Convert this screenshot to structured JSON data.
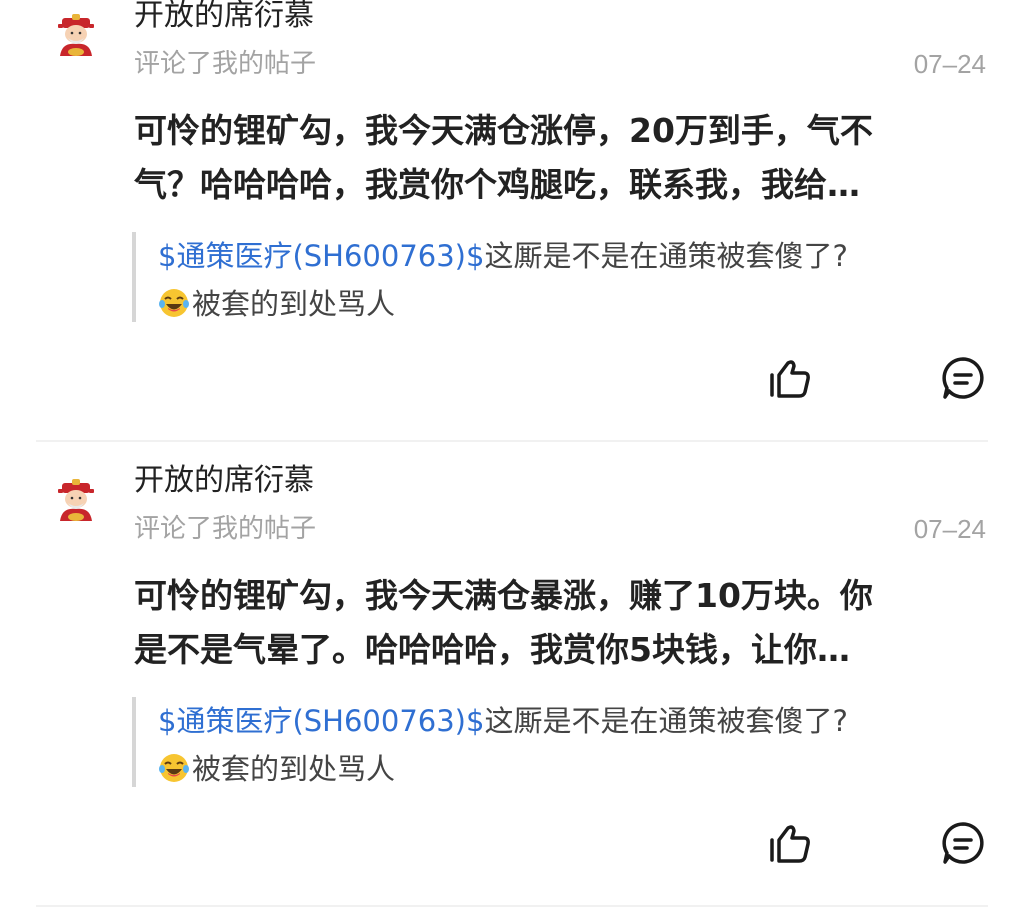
{
  "notifications": [
    {
      "username": "开放的席衍慕",
      "action": "评论了我的帖子",
      "date": "07–24",
      "content_line1": "可怜的锂矿勾，我今天满仓涨停，20万到手，气不",
      "content_line2": "气？哈哈哈哈，我赏你个鸡腿吃，联系我，我给…",
      "quote_stock": "$通策医疗(SH600763)$",
      "quote_text": "这厮是不是在通策被套傻了?",
      "quote_line2": "被套的到处骂人",
      "quote_emoji": "laughing-tears-emoji",
      "like_icon": "thumbs-up-icon",
      "comment_icon": "comment-bubble-icon"
    },
    {
      "username": "开放的席衍慕",
      "action": "评论了我的帖子",
      "date": "07–24",
      "content_line1": "可怜的锂矿勾，我今天满仓暴涨，赚了10万块。你",
      "content_line2": "是不是气晕了。哈哈哈哈，我赏你5块钱，让你…",
      "quote_stock": "$通策医疗(SH600763)$",
      "quote_text": "这厮是不是在通策被套傻了?",
      "quote_line2": "被套的到处骂人",
      "quote_emoji": "laughing-tears-emoji",
      "like_icon": "thumbs-up-icon",
      "comment_icon": "comment-bubble-icon"
    }
  ],
  "colors": {
    "stock_link": "#2f6fd2",
    "secondary_text": "#a3a3a3",
    "primary_text": "#222222",
    "quote_bar": "#d6d6d6"
  }
}
